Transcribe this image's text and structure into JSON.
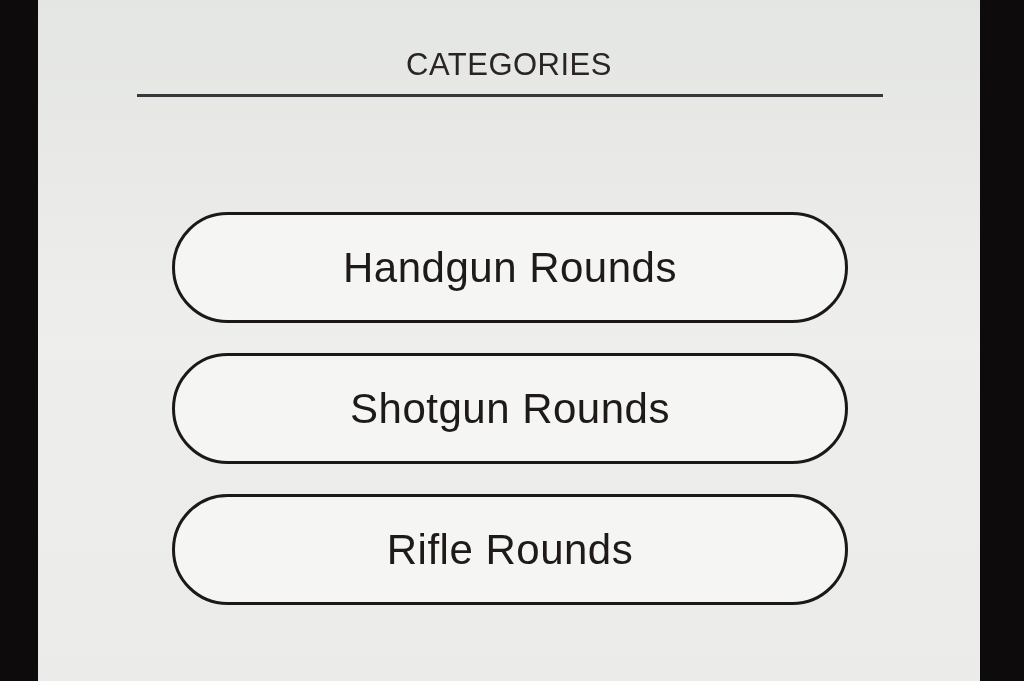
{
  "screen": {
    "title": "CATEGORIES"
  },
  "categories": [
    {
      "label": "Handgun Rounds"
    },
    {
      "label": "Shotgun Rounds"
    },
    {
      "label": "Rifle Rounds"
    }
  ]
}
